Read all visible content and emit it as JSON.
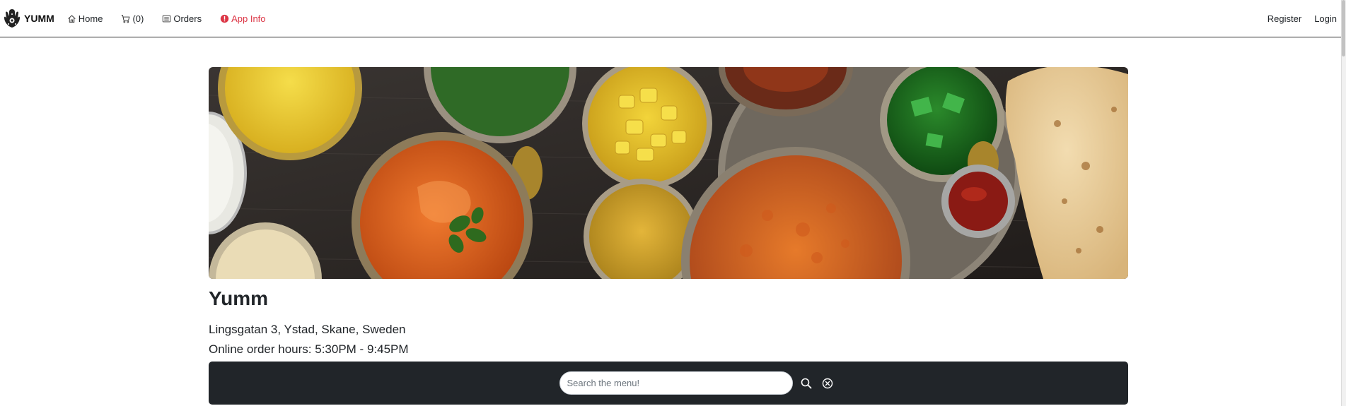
{
  "navbar": {
    "brand": "YUMM",
    "links": [
      {
        "label": "Home",
        "icon": "house-icon"
      },
      {
        "label": "(0)",
        "icon": "cart-icon"
      },
      {
        "label": "Orders",
        "icon": "list-icon"
      },
      {
        "label": "App Info",
        "icon": "info-icon"
      }
    ],
    "right": {
      "register": "Register",
      "login": "Login"
    }
  },
  "restaurant": {
    "name": "Yumm",
    "address": "Lingsgatan 3, Ystad, Skane, Sweden",
    "hours": "Online order hours: 5:30PM - 9:45PM",
    "hero_image": "indian-food-spread"
  },
  "search": {
    "placeholder": "Search the menu!",
    "value": "",
    "search_icon": "search-icon",
    "clear_icon": "clear-circle-icon"
  },
  "colors": {
    "info": "#dc3545",
    "search_bar_bg": "#212529",
    "navbar_border": "#2b2b2b"
  }
}
